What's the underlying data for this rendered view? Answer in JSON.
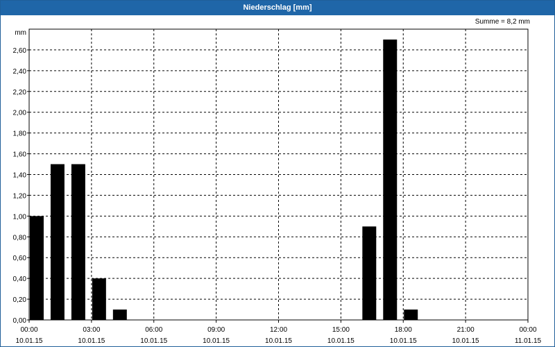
{
  "window": {
    "title": "Niederschlag [mm]"
  },
  "summary": {
    "text": "Summe = 8,2 mm"
  },
  "chart_data": {
    "type": "bar",
    "title": "Niederschlag [mm]",
    "ylabel": "mm",
    "ylim": [
      0,
      2.8
    ],
    "yticks": [
      "0,00",
      "0,20",
      "0,40",
      "0,60",
      "0,80",
      "1,00",
      "1,20",
      "1,40",
      "1,60",
      "1,80",
      "2,00",
      "2,20",
      "2,40",
      "2,60"
    ],
    "xticks": [
      {
        "time": "00:00",
        "date": "10.01.15"
      },
      {
        "time": "03:00",
        "date": "10.01.15"
      },
      {
        "time": "06:00",
        "date": "10.01.15"
      },
      {
        "time": "09:00",
        "date": "10.01.15"
      },
      {
        "time": "12:00",
        "date": "10.01.15"
      },
      {
        "time": "15:00",
        "date": "10.01.15"
      },
      {
        "time": "18:00",
        "date": "10.01.15"
      },
      {
        "time": "21:00",
        "date": "10.01.15"
      },
      {
        "time": "00:00",
        "date": "11.01.15"
      }
    ],
    "categories": [
      "00:00",
      "01:00",
      "02:00",
      "03:00",
      "04:00",
      "05:00",
      "06:00",
      "07:00",
      "08:00",
      "09:00",
      "10:00",
      "11:00",
      "12:00",
      "13:00",
      "14:00",
      "15:00",
      "16:00",
      "17:00",
      "18:00",
      "19:00",
      "20:00",
      "21:00",
      "22:00",
      "23:00"
    ],
    "values": [
      1.0,
      1.5,
      1.5,
      0.4,
      0.1,
      0,
      0,
      0,
      0,
      0,
      0,
      0,
      0,
      0,
      0,
      0,
      0.9,
      2.7,
      0.1,
      0,
      0,
      0,
      0,
      0
    ],
    "grid": true,
    "colors": {
      "bar": "#000000",
      "grid": "#000000",
      "title_bg": "#1f66a8"
    }
  }
}
